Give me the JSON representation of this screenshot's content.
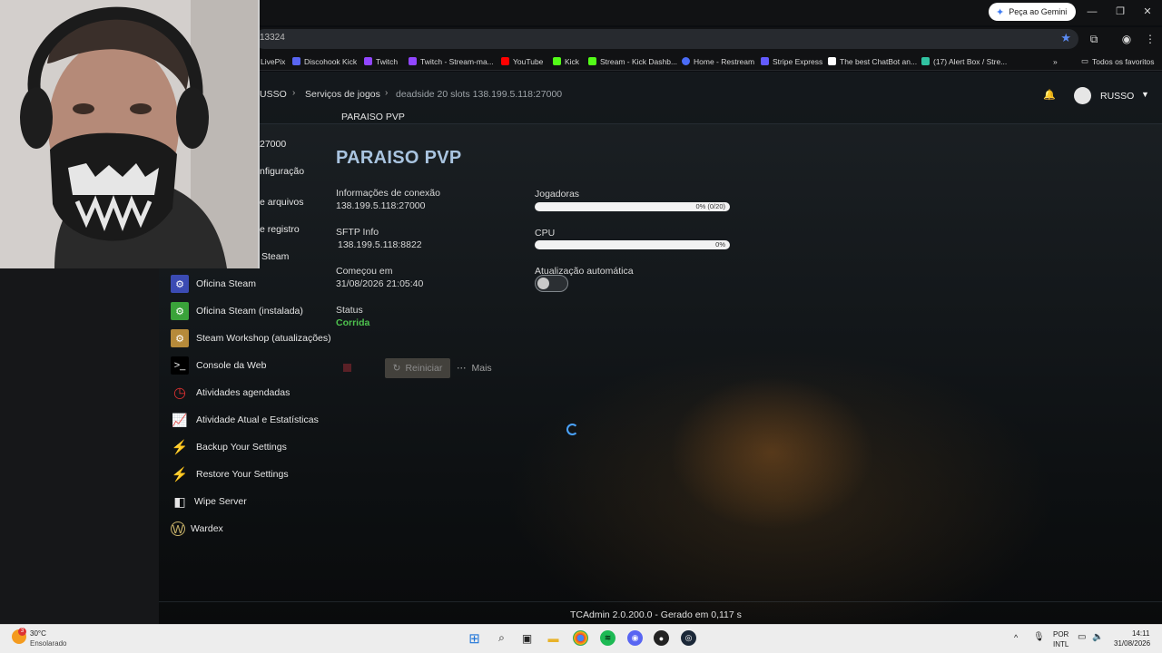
{
  "browser": {
    "gemini_label": "Peça ao Gemini",
    "url_fragment": "13324",
    "bookmarks": [
      {
        "label": "LivePix",
        "color": "#2ecc71"
      },
      {
        "label": "Discohook Kick",
        "color": "#5865f2"
      },
      {
        "label": "Twitch",
        "color": "#9146ff"
      },
      {
        "label": "Twitch - Stream-ma...",
        "color": "#9146ff"
      },
      {
        "label": "YouTube",
        "color": "#ff0000"
      },
      {
        "label": "Kick",
        "color": "#53fc18"
      },
      {
        "label": "Stream - Kick Dashb...",
        "color": "#53fc18"
      },
      {
        "label": "Home - Restream",
        "color": "#4a6cf7"
      },
      {
        "label": "Stripe Express",
        "color": "#635bff"
      },
      {
        "label": "The best ChatBot an...",
        "color": "#ffffff"
      },
      {
        "label": "(17) Alert Box / Stre...",
        "color": "#31c3a2"
      }
    ],
    "favorites_label": "Todos os favoritos"
  },
  "header": {
    "crumb_user": "USSO",
    "crumb_services": "Serviços de jogos",
    "crumb_server": "deadside 20 slots 138.199.5.118:27000",
    "subtitle": "PARAISO PVP",
    "username": "RUSSO"
  },
  "sidebar": {
    "partial_items": [
      "27000",
      "nfiguração",
      "e arquivos",
      "e registro",
      "Steam"
    ],
    "items": [
      {
        "label": "Oficina Steam",
        "icon": "workshop-icon",
        "color": "#3b4bb3"
      },
      {
        "label": "Oficina Steam (instalada)",
        "icon": "workshop-installed-icon",
        "color": "#3aa33a"
      },
      {
        "label": "Steam Workshop (atualizações)",
        "icon": "workshop-update-icon",
        "color": "#b68a3a"
      },
      {
        "label": "Console da Web",
        "icon": "terminal-icon",
        "color": "#000000"
      },
      {
        "label": "Atividades agendadas",
        "icon": "clock-icon",
        "color": "#d83030"
      },
      {
        "label": "Atividade Atual e Estatísticas",
        "icon": "chart-icon",
        "color": "#6b8fb0"
      },
      {
        "label": "Backup Your Settings",
        "icon": "lightning-icon",
        "color": "#f2e100"
      },
      {
        "label": "Restore Your Settings",
        "icon": "lightning-icon",
        "color": "#f2e100"
      },
      {
        "label": "Wipe Server",
        "icon": "eraser-icon",
        "color": "#dddddd"
      },
      {
        "label": "Wardex",
        "icon": "wardex-icon",
        "color": "#c9b36a"
      }
    ]
  },
  "main": {
    "title": "PARAISO PVP",
    "connection_label": "Informações de conexão",
    "connection_value": "138.199.5.118:27000",
    "sftp_label": "SFTP Info",
    "sftp_value": "138.199.5.118:8822",
    "started_label": "Começou em",
    "started_value": "31/08/2026 21:05:40",
    "status_label": "Status",
    "status_value": "Corrida",
    "players_label": "Jogadoras",
    "players_text": "0% (0/20)",
    "players_fraction": 0,
    "cpu_label": "CPU",
    "cpu_text": "0%",
    "cpu_fraction": 0,
    "autoupdate_label": "Atualização automática",
    "autoupdate_on": false,
    "restart_label": "Reiniciar",
    "more_label": "Mais"
  },
  "footer": {
    "text": "TCAdmin 2.0.200.0 - Gerado em 0,117 s"
  },
  "taskbar": {
    "weather_temp": "30°C",
    "weather_desc": "Ensolarado",
    "weather_badge": "3",
    "lang_top": "POR",
    "lang_bottom": "INTL",
    "time": "14:11",
    "date": "31/08/2026"
  }
}
